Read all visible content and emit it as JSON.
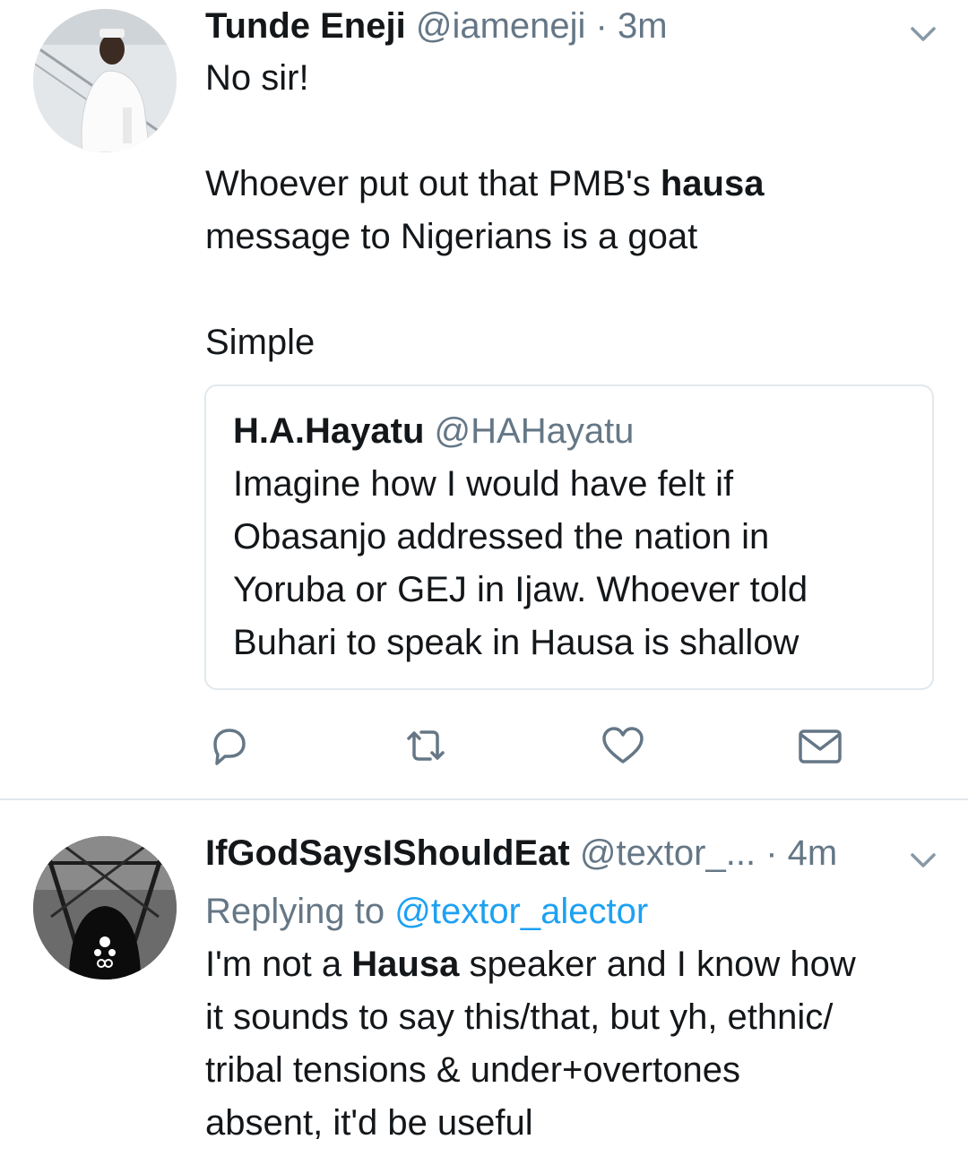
{
  "tweet1": {
    "name": "Tunde Eneji",
    "handle": "@iameneji",
    "separator": "·",
    "time": "3m",
    "avatar_icon": "avatar-photo-icon",
    "line1": "No sir!",
    "line2_pre": "Whoever put out that PMB's ",
    "line2_bold": "hausa",
    "line3": "message to Nigerians is a goat",
    "line4": "Simple",
    "quote": {
      "name": "H.A.Hayatu",
      "handle": "@HAHayatu",
      "lines": [
        "Imagine how I would have felt if",
        "Obasanjo addressed the nation in",
        "Yoruba or GEJ in Ijaw. Whoever told",
        "Buhari to speak in Hausa is shallow"
      ]
    },
    "actions": {
      "reply_icon": "reply-icon",
      "retweet_icon": "retweet-icon",
      "like_icon": "heart-icon",
      "dm_icon": "envelope-icon"
    }
  },
  "tweet2": {
    "name": "IfGodSaysIShouldEat",
    "handle": "@textor_...",
    "separator": "·",
    "time": "4m",
    "avatar_icon": "avatar-photo-icon",
    "replying_label": "Replying to ",
    "replying_to": "@textor_alector",
    "line1_pre": "I'm not a ",
    "line1_bold": "Hausa",
    "line1_post": " speaker and I know how",
    "line2": "it sounds to say this/that, but yh, ethnic/",
    "line3": "tribal tensions & under+overtones",
    "line4": "absent, it'd be useful"
  },
  "colors": {
    "text": "#14171a",
    "secondary": "#657786",
    "link": "#1da1f2",
    "border": "#e1e8ed"
  }
}
